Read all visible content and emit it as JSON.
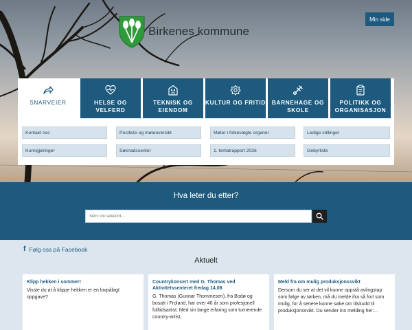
{
  "header": {
    "logo_text": "Birkenes kommune",
    "min_side_label": "Min side"
  },
  "nav": {
    "tabs": [
      {
        "label": "SNARVEIER",
        "icon": "share-arrow-icon",
        "active": true
      },
      {
        "label": "HELSE OG VELFERD",
        "icon": "heart-pulse-icon",
        "active": false
      },
      {
        "label": "TEKNISK OG EIENDOM",
        "icon": "building-icon",
        "active": false
      },
      {
        "label": "KULTUR OG FRITID",
        "icon": "flower-icon",
        "active": false
      },
      {
        "label": "BARNEHAGE OG SKOLE",
        "icon": "toy-icon",
        "active": false
      },
      {
        "label": "POLITIKK OG ORGANISASJON",
        "icon": "clipboard-icon",
        "active": false
      }
    ],
    "links": [
      "Kontakt oss",
      "Postliste og møteoversikt",
      "Møter i folkevalgte organer",
      "Ledige stillinger",
      "Kunngjøringer",
      "Søknadssenter",
      "1. tertialrapport 2026",
      "Gebyrliste"
    ]
  },
  "search": {
    "title": "Hva leter du etter?",
    "placeholder": "Skriv inn søkeord..."
  },
  "social": {
    "facebook_label": "Følg oss på Facebook"
  },
  "news": {
    "heading": "Aktuelt",
    "items": [
      {
        "title": "Klipp hekken i sommer!",
        "body": "Visste du at å klippe hekken er en lovpålagt oppgave?"
      },
      {
        "title": "Countrykonsert med G. Thomas ved Aktivitetssenteret fredag 14.08",
        "body": "G. Thomas (Gunnar Thommesen), fra Bodø og bosatt i Froland, har over 40 år som profesjonell fulltidsartist. Med sin lange erfaring som turnerende country-artist,"
      },
      {
        "title": "Meld fra om mulig produksjonssvikt",
        "body": "Dersom du ser at det vil kunne oppstå avlingstap som følge av tørken, må du melde ifra så fort som mulig, for å senere kunne søke om tilskudd til produksjonssvikt. Du sender inn melding her:..."
      }
    ]
  },
  "colors": {
    "brand": "#1d5a7e",
    "link_bg": "#d6e2ec",
    "logo_green": "#2e9a3a"
  }
}
